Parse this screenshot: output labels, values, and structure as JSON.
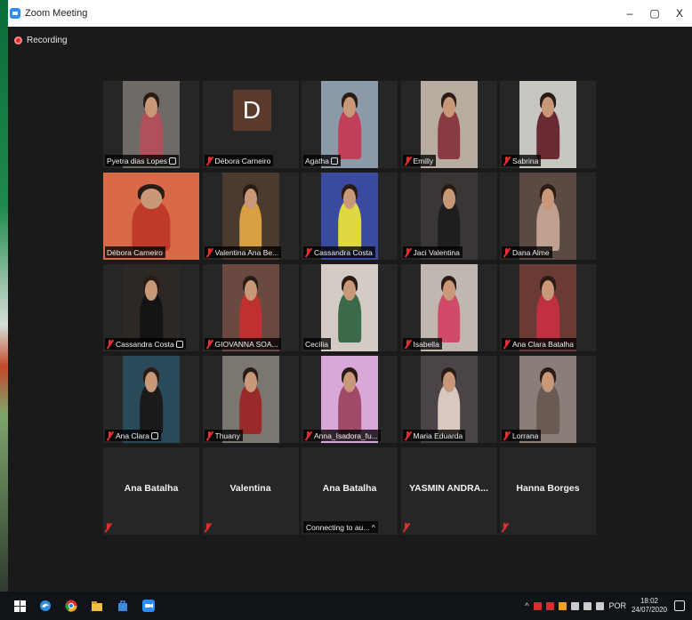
{
  "window": {
    "title": "Zoom Meeting",
    "controls": [
      "–",
      "▢",
      "X"
    ]
  },
  "recording": {
    "label": "Recording"
  },
  "tiles": [
    {
      "name": "Pyetra dias Lopes",
      "muted": false,
      "badge": true,
      "bg": "#6e6a66",
      "shirt": "#b0505a"
    },
    {
      "name": "Débora Carneiro",
      "muted": true,
      "avatar": "D",
      "bg": "#262626"
    },
    {
      "name": "Agatha",
      "muted": false,
      "badge": true,
      "bg": "#8a9aa8",
      "shirt": "#c0405a"
    },
    {
      "name": "Emilly",
      "muted": true,
      "bg": "#b8aca0",
      "shirt": "#8a3a44"
    },
    {
      "name": "Sabrina",
      "muted": true,
      "bg": "#c8c6c0",
      "shirt": "#6a2a34"
    },
    {
      "name": "Débora Carneiro",
      "muted": false,
      "active": true,
      "wide": true,
      "bg": "#d86a4a",
      "shirt": "#c03a2a"
    },
    {
      "name": "Valentina Ana Be...",
      "muted": true,
      "bg": "#4a3a30",
      "shirt": "#d8a040"
    },
    {
      "name": "Cassandra Costa",
      "muted": true,
      "bg": "#3a4aa0",
      "shirt": "#e0d840"
    },
    {
      "name": "Jaci Valentina",
      "muted": true,
      "bg": "#3a3636",
      "shirt": "#1e1e1e"
    },
    {
      "name": "Dana Alme",
      "muted": true,
      "bg": "#5a4a44",
      "shirt": "#c0a090"
    },
    {
      "name": "Cassandra Costa",
      "muted": true,
      "badge": true,
      "bg": "#2e2824",
      "shirt": "#141414"
    },
    {
      "name": "GIOVANNA SOA...",
      "muted": true,
      "bg": "#6a4a40",
      "shirt": "#c03030"
    },
    {
      "name": "Cecília",
      "muted": false,
      "bg": "#d4ccc4",
      "shirt": "#3a6a4a"
    },
    {
      "name": "Isabella",
      "muted": true,
      "bg": "#c0b8b0",
      "shirt": "#d04a6a"
    },
    {
      "name": "Ana Clara Batalha",
      "muted": true,
      "bg": "#6a3a34",
      "shirt": "#c03040"
    },
    {
      "name": "Ana Clara",
      "muted": true,
      "badge": true,
      "bg": "#2a4a5a",
      "shirt": "#1a1a1a"
    },
    {
      "name": "Thuany",
      "muted": true,
      "bg": "#7a7670",
      "shirt": "#9a2a2a"
    },
    {
      "name": "Anna_Isadora_fu...",
      "muted": true,
      "bg": "#d8a8d8",
      "shirt": "#a04a6a"
    },
    {
      "name": "Maria Eduarda",
      "muted": true,
      "bg": "#4a4448",
      "shirt": "#d8c8c0"
    },
    {
      "name": "Lorrana",
      "muted": true,
      "bg": "#8a7e78",
      "shirt": "#6a5a54"
    }
  ],
  "noVideoTiles": [
    {
      "name": "Ana Batalha",
      "muted": true
    },
    {
      "name": "Valentina",
      "muted": true
    },
    {
      "name": "Ana Batalha",
      "muted": false,
      "status": "Connecting to au... ^"
    },
    {
      "name": "YASMIN ANDRA...",
      "muted": true
    },
    {
      "name": "Hanna Borges",
      "muted": true
    }
  ],
  "taskbar": {
    "icons": [
      "windows-start",
      "edge",
      "chrome",
      "file-explorer",
      "store",
      "zoom"
    ],
    "tray": {
      "chevron": "^",
      "lang": "POR",
      "time": "18:02",
      "date": "24/07/2020"
    },
    "colors": {
      "edge": "#2f8ee0",
      "chrome": "#f0b020",
      "explorer": "#f0c040",
      "store": "#3a8ae0",
      "zoom": "#2d8cff"
    }
  }
}
